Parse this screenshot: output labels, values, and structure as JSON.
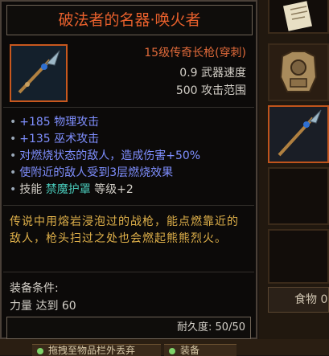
{
  "tooltip": {
    "title": "破法者的名器·唤火者",
    "item_type": "15级传奇长枪(穿刺)",
    "attack_speed": "0.9 武器速度",
    "attack_range": "500 攻击范围",
    "affixes": [
      {
        "text": "+185 物理攻击"
      },
      {
        "text": "+135 巫术攻击"
      },
      {
        "text": "对燃烧状态的敌人，造成伤害+50%"
      },
      {
        "text": "使附近的敌人受到3层燃烧效果"
      }
    ],
    "skill_prefix": "技能",
    "skill_name": "禁魔护罩",
    "skill_level": "等级+2",
    "lore": "传说中用熔岩浸泡过的战枪，能点燃靠近的敌人，枪头扫过之处也会燃起熊熊烈火。",
    "requirement_label": "装备条件:",
    "requirement_value": "力量 达到 60",
    "durability": "耐久度: 50/50"
  },
  "inventory": {
    "food_label": "食物 0"
  },
  "bottom_bar": {
    "left_text": "拖拽至物品栏外丢弃",
    "right_text": "装备"
  },
  "colors": {
    "title": "#e8602c",
    "item_type": "#e06a3a",
    "affix": "#7f8fff",
    "skill": "#48c8b8",
    "lore": "#e0b14a",
    "frame_active": "#c8581e"
  }
}
